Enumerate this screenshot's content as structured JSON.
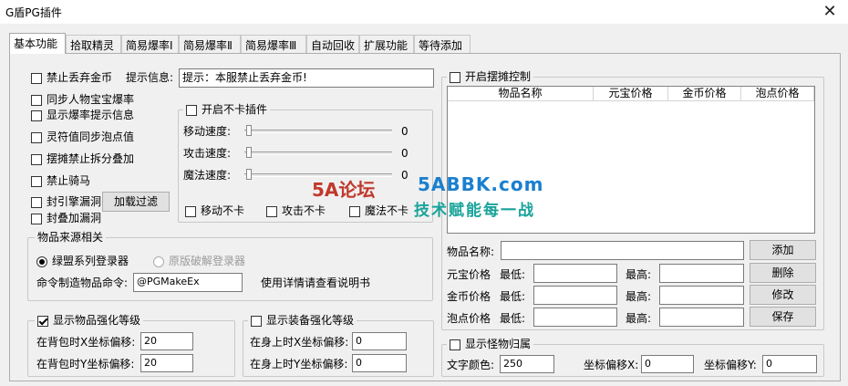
{
  "window": {
    "title": "G盾PG插件",
    "close": "✕"
  },
  "tabs": [
    "基本功能",
    "拾取精灵",
    "简易爆率Ⅰ",
    "简易爆率Ⅱ",
    "简易爆率Ⅲ",
    "自动回收",
    "扩展功能",
    "等待添加"
  ],
  "basic": {
    "ban_drop_gold": "禁止丢弃金币",
    "hint_label": "提示信息:",
    "hint_value": "提示：本服禁止丢弃金币!",
    "sync_drop": "同步人物宝宝爆率",
    "show_drop_hint": "显示爆率提示信息",
    "spirit_sync": "灵符值同步泡点值",
    "stall_no_split": "摆摊禁止拆分叠加",
    "no_mount": "禁止骑马",
    "seal_engine": "封引擎漏洞",
    "load_filter": "加载过滤",
    "seal_stack": "封叠加漏洞"
  },
  "no_stuck": {
    "title": "开启不卡插件",
    "move_speed": "移动速度:",
    "attack_speed": "攻击速度:",
    "magic_speed": "魔法速度:",
    "move_value": "0",
    "attack_value": "0",
    "magic_value": "0",
    "move_nostuck": "移动不卡",
    "attack_nostuck": "攻击不卡",
    "magic_nostuck": "魔法不卡"
  },
  "item_source": {
    "title": "物品来源相关",
    "radio1": "绿盟系列登录器",
    "radio2": "原版破解登录器",
    "cmd_label": "命令制造物品命令:",
    "cmd_value": "@PGMakeEx",
    "cmd_note": "使用详情请查看说明书"
  },
  "item_enhance": {
    "title": "显示物品强化等级",
    "x_label": "在背包时X坐标偏移:",
    "x_value": "20",
    "y_label": "在背包时Y坐标偏移:",
    "y_value": "20"
  },
  "equip_enhance": {
    "title": "显示装备强化等级",
    "x_label": "在身上时X坐标偏移:",
    "x_value": "0",
    "y_label": "在身上时Y坐标偏移:",
    "y_value": "0"
  },
  "stall": {
    "title": "开启摆摊控制",
    "columns": [
      "物品名称",
      "元宝价格",
      "金币价格",
      "泡点价格"
    ],
    "item_name_label": "物品名称:",
    "yuanbao_label": "元宝价格",
    "gold_label": "金币价格",
    "bubble_label": "泡点价格",
    "min_label": "最低:",
    "max_label": "最高:",
    "add": "添加",
    "delete": "删除",
    "modify": "修改",
    "save": "保存"
  },
  "monster": {
    "title": "显示怪物归属",
    "color_label": "文字颜色:",
    "color_value": "250",
    "x_label": "坐标偏移X:",
    "x_value": "0",
    "y_label": "坐标偏移Y:",
    "y_value": "0"
  },
  "watermark": {
    "site": "5ABBK.com",
    "slogan": "技术赋能每一战",
    "logo": "5A论坛"
  }
}
